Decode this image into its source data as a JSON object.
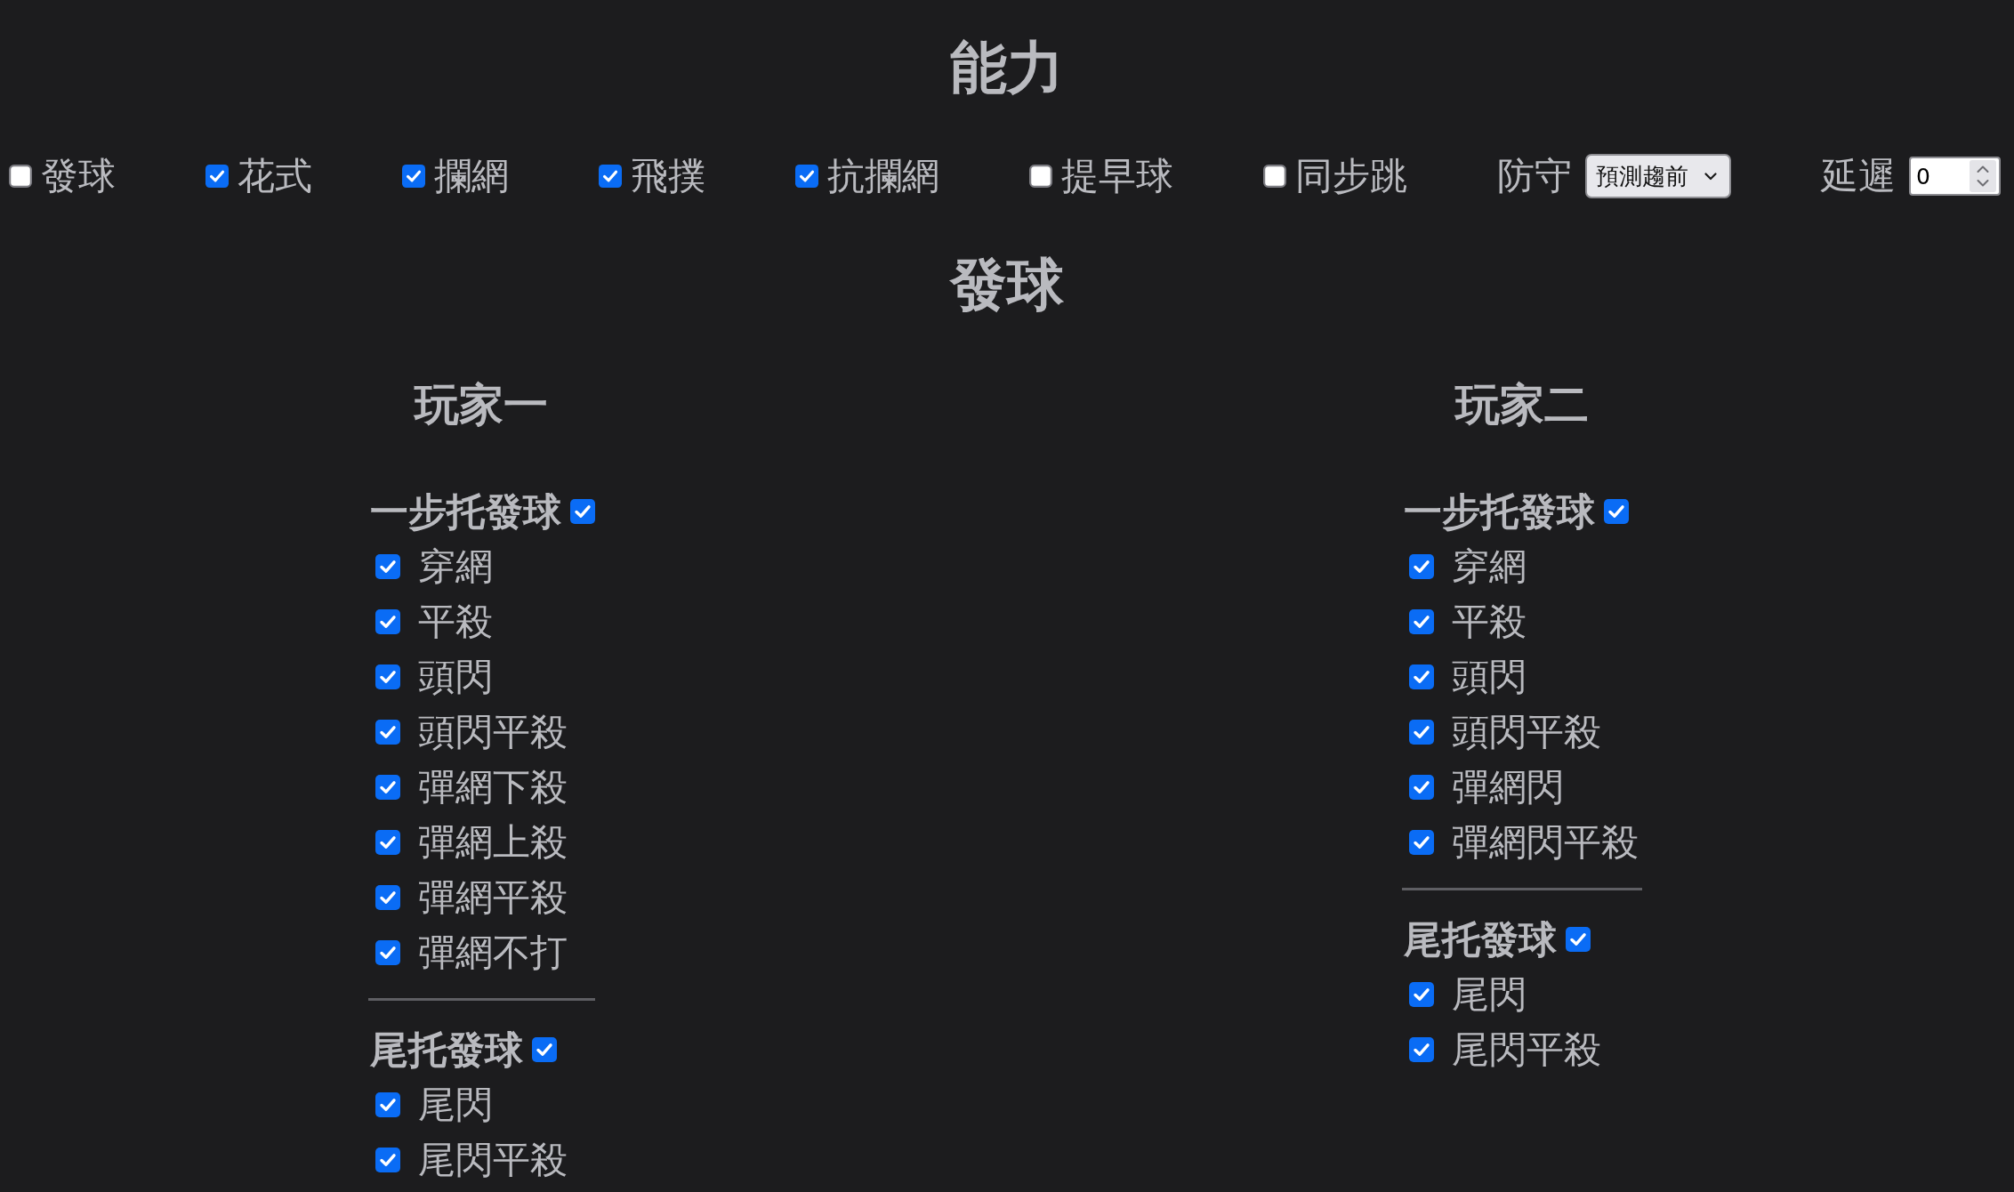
{
  "abilities": {
    "title": "能力",
    "options": [
      {
        "kind": "checkbox",
        "label": "發球",
        "checked": false
      },
      {
        "kind": "checkbox",
        "label": "花式",
        "checked": true
      },
      {
        "kind": "checkbox",
        "label": "攔網",
        "checked": true
      },
      {
        "kind": "checkbox",
        "label": "飛撲",
        "checked": true
      },
      {
        "kind": "checkbox",
        "label": "抗攔網",
        "checked": true
      },
      {
        "kind": "checkbox",
        "label": "提早球",
        "checked": false
      },
      {
        "kind": "checkbox",
        "label": "同步跳",
        "checked": false
      },
      {
        "kind": "select",
        "label": "防守",
        "value": "預測趨前"
      },
      {
        "kind": "number",
        "label": "延遲",
        "value": "0"
      }
    ]
  },
  "serve": {
    "title": "發球",
    "players": [
      {
        "name": "玩家一",
        "groups": [
          {
            "title": "一步托發球",
            "checked": true,
            "options": [
              {
                "label": "穿網",
                "checked": true
              },
              {
                "label": "平殺",
                "checked": true
              },
              {
                "label": "頭閃",
                "checked": true
              },
              {
                "label": "頭閃平殺",
                "checked": true
              },
              {
                "label": "彈網下殺",
                "checked": true
              },
              {
                "label": "彈網上殺",
                "checked": true
              },
              {
                "label": "彈網平殺",
                "checked": true
              },
              {
                "label": "彈網不打",
                "checked": true
              }
            ]
          },
          {
            "title": "尾托發球",
            "checked": true,
            "options": [
              {
                "label": "尾閃",
                "checked": true
              },
              {
                "label": "尾閃平殺",
                "checked": true
              }
            ]
          }
        ]
      },
      {
        "name": "玩家二",
        "groups": [
          {
            "title": "一步托發球",
            "checked": true,
            "options": [
              {
                "label": "穿網",
                "checked": true
              },
              {
                "label": "平殺",
                "checked": true
              },
              {
                "label": "頭閃",
                "checked": true
              },
              {
                "label": "頭閃平殺",
                "checked": true
              },
              {
                "label": "彈網閃",
                "checked": true
              },
              {
                "label": "彈網閃平殺",
                "checked": true
              }
            ]
          },
          {
            "title": "尾托發球",
            "checked": true,
            "options": [
              {
                "label": "尾閃",
                "checked": true
              },
              {
                "label": "尾閃平殺",
                "checked": true
              }
            ]
          }
        ]
      }
    ]
  }
}
